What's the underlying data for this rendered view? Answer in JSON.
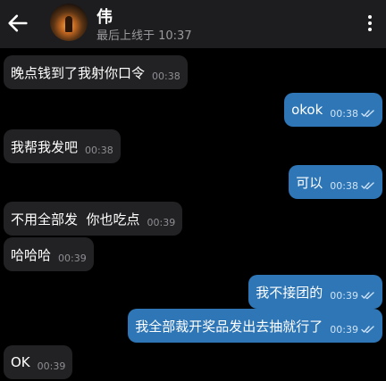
{
  "header": {
    "back_icon": "arrow-left-icon",
    "title": "伟",
    "subtitle": "最后上线于 10:37",
    "menu_icon": "more-vertical-icon"
  },
  "messages": [
    {
      "direction": "in",
      "text": "晚点钱到了我射你口令",
      "time": "00:38"
    },
    {
      "direction": "out",
      "text": "okok",
      "time": "00:38",
      "status_icon": "double-check-icon"
    },
    {
      "direction": "in",
      "text": "我帮我发吧",
      "time": "00:38"
    },
    {
      "direction": "out",
      "text": "可以",
      "time": "00:38",
      "status_icon": "double-check-icon"
    },
    {
      "direction": "in",
      "text": "不用全部发  你也吃点",
      "time": "00:39"
    },
    {
      "direction": "in",
      "text": "哈哈哈",
      "time": "00:39"
    },
    {
      "direction": "out",
      "text": "我不接团的",
      "time": "00:39",
      "status_icon": "double-check-icon"
    },
    {
      "direction": "out",
      "text": "我全部裁开奖品发出去抽就行了",
      "time": "00:39",
      "status_icon": "double-check-icon"
    },
    {
      "direction": "in",
      "text": "OK",
      "time": "00:39"
    }
  ],
  "colors": {
    "background": "#000000",
    "header": "#1d1d1f",
    "incoming_bubble": "#222224",
    "outgoing_bubble": "#2e76b6"
  }
}
